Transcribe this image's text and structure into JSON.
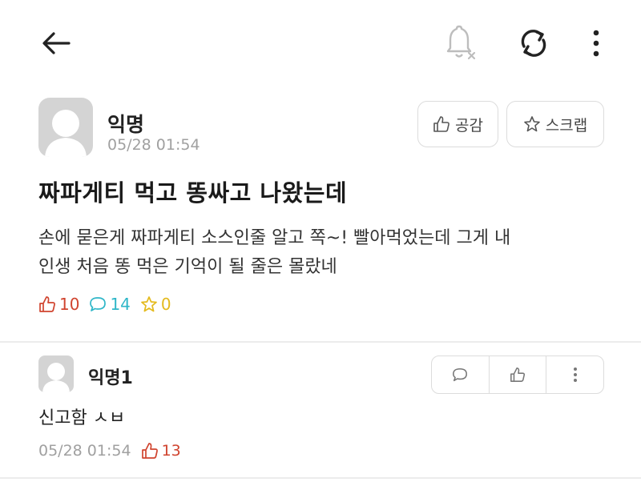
{
  "post": {
    "author": "익명",
    "date": "05/28 01:54",
    "like_button_label": "공감",
    "scrap_button_label": "스크랩",
    "title": "짜파게티 먹고 똥싸고 나왔는데",
    "body_line1": "손에 묻은게 짜파게티 소스인줄 알고 쪽~! 빨아먹었는데 그게 내",
    "body_line2": "인생 처음 똥 먹은 기억이 될 줄은 몰랐네",
    "stats": {
      "likes": "10",
      "comments": "14",
      "scraps": "0"
    }
  },
  "comment": {
    "author": "익명1",
    "text": "신고함 ㅅㅂ",
    "date": "05/28 01:54",
    "likes": "13"
  },
  "icons": {
    "back": "arrow-left-icon",
    "notifications": "bell-off-icon",
    "refresh": "refresh-icon",
    "more": "more-vertical-icon"
  },
  "colors": {
    "likes": "#d0442f",
    "comments": "#2eb6c8",
    "scraps": "#e4ba1d",
    "muted": "#a0a0a0"
  }
}
